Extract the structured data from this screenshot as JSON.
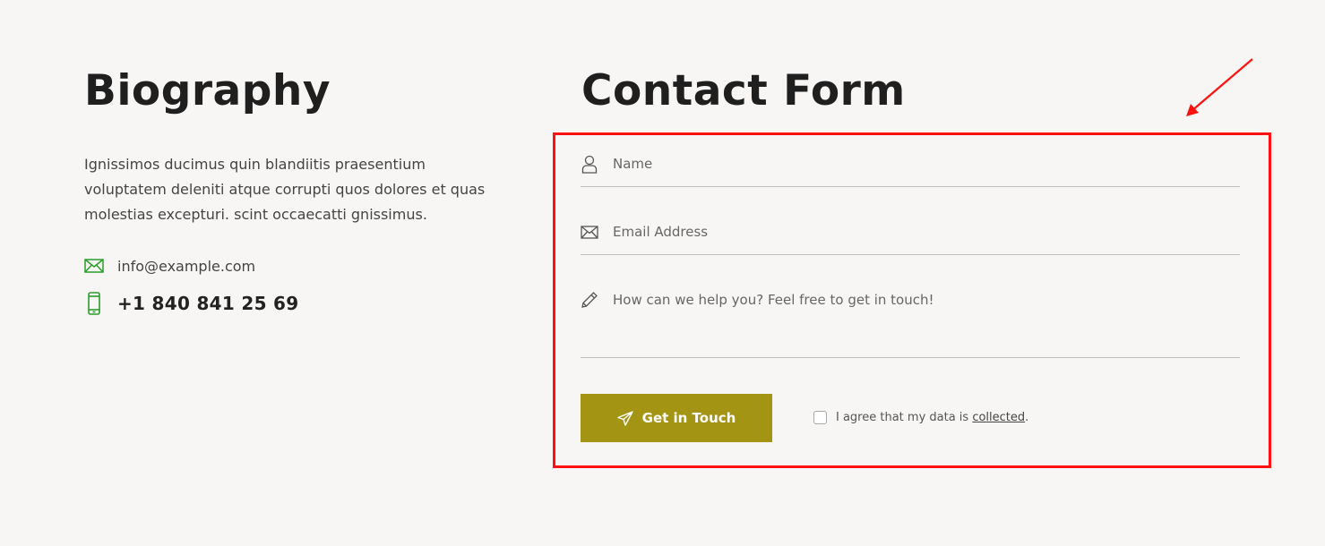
{
  "biography": {
    "title": "Biography",
    "text": "Ignissimos ducimus quin blandiitis praesentium voluptatem deleniti atque corrupti quos dolores et quas molestias excepturi. scint occaecatti gnissimus.",
    "email": "info@example.com",
    "phone": "+1 840 841 25 69",
    "icon_color": "#2a9d2a"
  },
  "contact_form": {
    "title": "Contact Form",
    "name_placeholder": "Name",
    "email_placeholder": "Email Address",
    "message_placeholder": "How can we help you? Feel free to get in touch!",
    "submit_label": "Get in Touch",
    "agree_prefix": "I agree that my data is ",
    "agree_link": "collected",
    "agree_suffix": ".",
    "button_color": "#a39414"
  },
  "annotation": {
    "highlight_color": "#ff1111"
  }
}
